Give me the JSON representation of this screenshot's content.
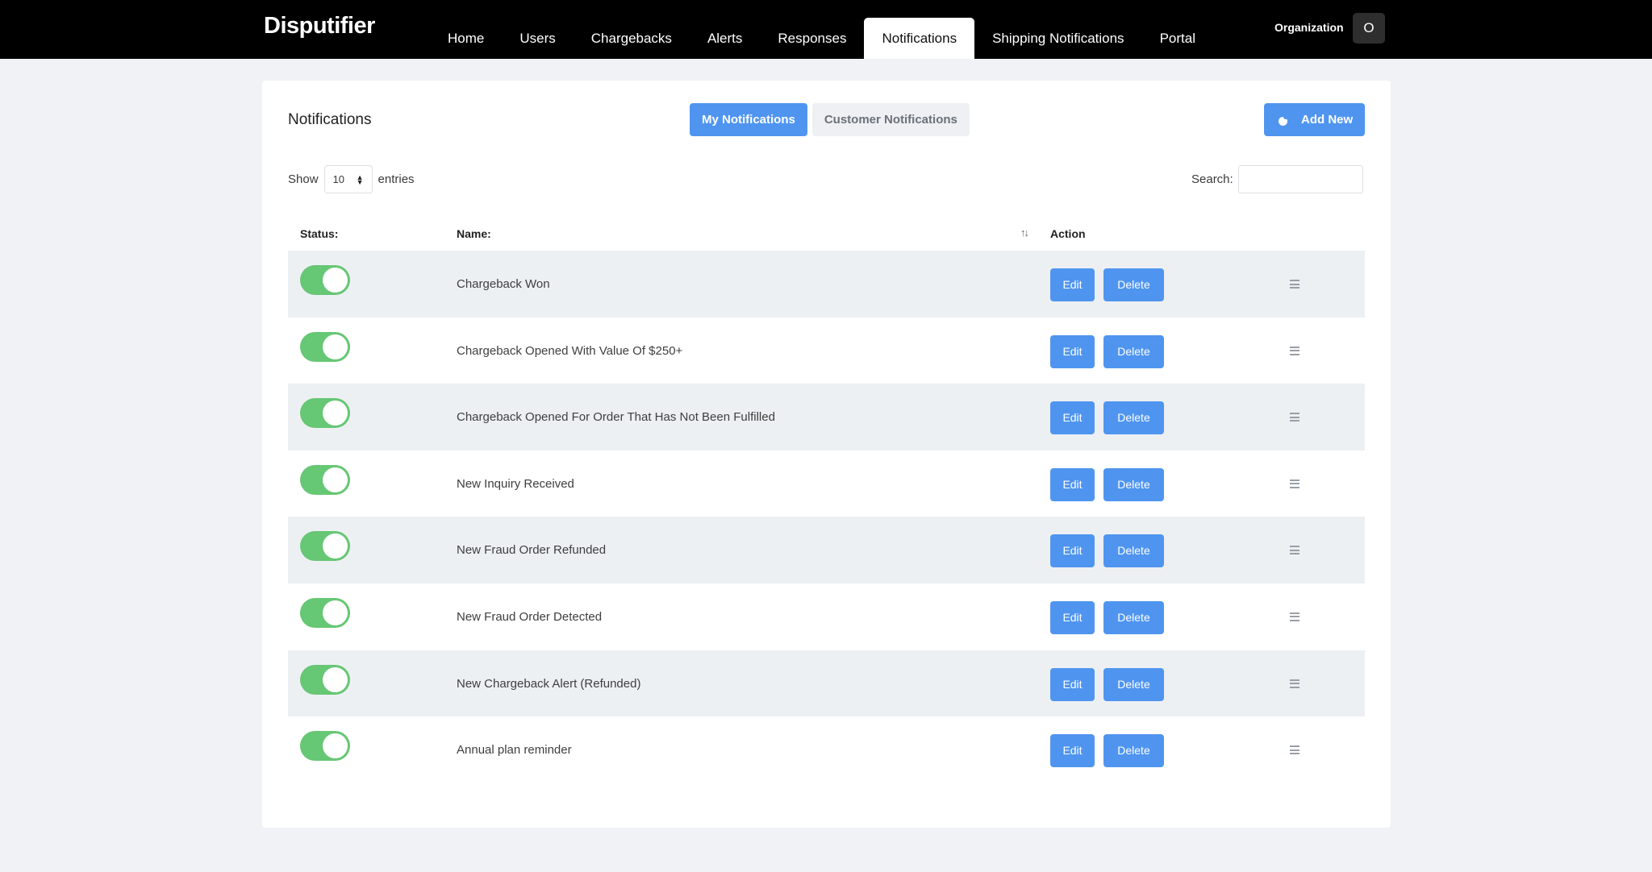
{
  "app": {
    "logo": "Disputifier"
  },
  "nav": {
    "items": [
      {
        "label": "Home",
        "active": false
      },
      {
        "label": "Users",
        "active": false
      },
      {
        "label": "Chargebacks",
        "active": false
      },
      {
        "label": "Alerts",
        "active": false
      },
      {
        "label": "Responses",
        "active": false
      },
      {
        "label": "Notifications",
        "active": true
      },
      {
        "label": "Shipping Notifications",
        "active": false
      },
      {
        "label": "Portal",
        "active": false
      }
    ],
    "org_label": "Organization",
    "avatar_letter": "O"
  },
  "page": {
    "title": "Notifications",
    "tabs": [
      {
        "label": "My Notifications",
        "active": true
      },
      {
        "label": "Customer Notifications",
        "active": false
      }
    ],
    "add_button": "Add New",
    "show_label": "Show",
    "entries_value": "10",
    "entries_label": "entries",
    "search_label": "Search:",
    "search_value": ""
  },
  "table": {
    "columns": {
      "status": "Status:",
      "name": "Name:",
      "action": "Action"
    },
    "edit_label": "Edit",
    "delete_label": "Delete",
    "rows": [
      {
        "name": "Chargeback Won",
        "enabled": true
      },
      {
        "name": "Chargeback Opened With Value Of $250+",
        "enabled": true
      },
      {
        "name": "Chargeback Opened For Order That Has Not Been Fulfilled",
        "enabled": true
      },
      {
        "name": "New Inquiry Received",
        "enabled": true
      },
      {
        "name": "New Fraud Order Refunded",
        "enabled": true
      },
      {
        "name": "New Fraud Order Detected",
        "enabled": true
      },
      {
        "name": "New Chargeback Alert (Refunded)",
        "enabled": true
      },
      {
        "name": "Annual plan reminder",
        "enabled": true
      }
    ]
  },
  "colors": {
    "accent": "#4f95f0",
    "toggle_on": "#66c774",
    "topbar": "#000000"
  }
}
